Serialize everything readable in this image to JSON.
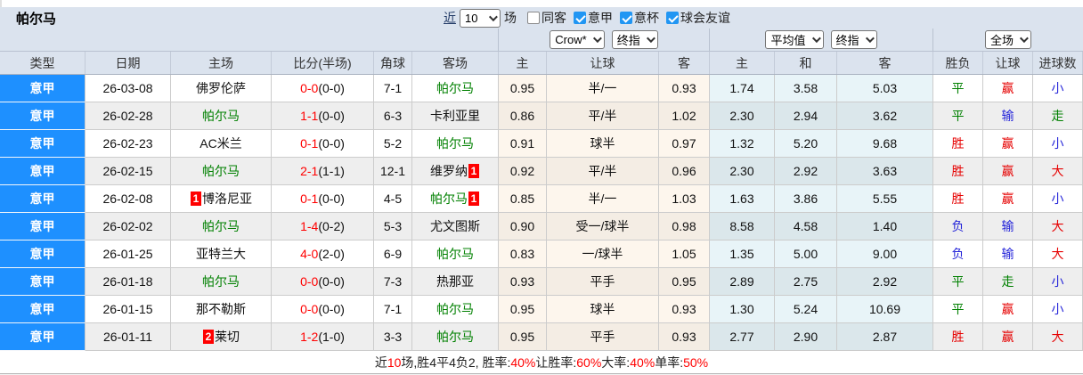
{
  "theme": {
    "accent_blue": "#1e90ff",
    "header_bg": "#dbe3ee",
    "green": "#008000",
    "red": "#e60000",
    "blue": "#2626d9",
    "score_red": "#ff0000"
  },
  "team_header": {
    "title": "帕尔马",
    "near_label": "近",
    "matches_select_value": "10",
    "matches_suffix": "场",
    "filters": [
      {
        "label": "同客",
        "checked": false
      },
      {
        "label": "意甲",
        "checked": true
      },
      {
        "label": "意杯",
        "checked": true
      },
      {
        "label": "球会友谊",
        "checked": true
      }
    ]
  },
  "filter_row": {
    "asia_selects": [
      "Crow*",
      "终指"
    ],
    "euro_selects": [
      "平均值",
      "终指"
    ],
    "scope_select": "全场"
  },
  "table": {
    "columns": [
      "类型",
      "日期",
      "主场",
      "比分(半场)",
      "角球",
      "客场",
      "主",
      "让球",
      "客",
      "主",
      "和",
      "客",
      "胜负",
      "让球",
      "进球数"
    ],
    "rows": [
      {
        "league": "意甲",
        "date": "26-03-08",
        "home": "佛罗伦萨",
        "home_green": false,
        "home_badge": "",
        "score": "0-0",
        "half": "(0-0)",
        "corner": "7-1",
        "away": "帕尔马",
        "away_green": true,
        "away_badge": "",
        "asia": [
          "0.95",
          "半/一",
          "0.93"
        ],
        "euro": [
          "1.74",
          "3.58",
          "5.03"
        ],
        "result": {
          "text": "平",
          "color": "green"
        },
        "handicap": {
          "text": "赢",
          "color": "red"
        },
        "goals": {
          "text": "小",
          "color": "blue"
        }
      },
      {
        "league": "意甲",
        "date": "26-02-28",
        "home": "帕尔马",
        "home_green": true,
        "home_badge": "",
        "score": "1-1",
        "half": "(0-0)",
        "corner": "6-3",
        "away": "卡利亚里",
        "away_green": false,
        "away_badge": "",
        "asia": [
          "0.86",
          "平/半",
          "1.02"
        ],
        "euro": [
          "2.30",
          "2.94",
          "3.62"
        ],
        "result": {
          "text": "平",
          "color": "green"
        },
        "handicap": {
          "text": "输",
          "color": "blue"
        },
        "goals": {
          "text": "走",
          "color": "green"
        }
      },
      {
        "league": "意甲",
        "date": "26-02-23",
        "home": "AC米兰",
        "home_green": false,
        "home_badge": "",
        "score": "0-1",
        "half": "(0-0)",
        "corner": "5-2",
        "away": "帕尔马",
        "away_green": true,
        "away_badge": "",
        "asia": [
          "0.91",
          "球半",
          "0.97"
        ],
        "euro": [
          "1.32",
          "5.20",
          "9.68"
        ],
        "result": {
          "text": "胜",
          "color": "red"
        },
        "handicap": {
          "text": "赢",
          "color": "red"
        },
        "goals": {
          "text": "小",
          "color": "blue"
        }
      },
      {
        "league": "意甲",
        "date": "26-02-15",
        "home": "帕尔马",
        "home_green": true,
        "home_badge": "",
        "score": "2-1",
        "half": "(1-1)",
        "corner": "12-1",
        "away": "维罗纳",
        "away_green": false,
        "away_badge": "1",
        "asia": [
          "0.92",
          "平/半",
          "0.96"
        ],
        "euro": [
          "2.30",
          "2.92",
          "3.63"
        ],
        "result": {
          "text": "胜",
          "color": "red"
        },
        "handicap": {
          "text": "赢",
          "color": "red"
        },
        "goals": {
          "text": "大",
          "color": "red"
        }
      },
      {
        "league": "意甲",
        "date": "26-02-08",
        "home": "博洛尼亚",
        "home_green": false,
        "home_badge": "1",
        "score": "0-1",
        "half": "(0-0)",
        "corner": "4-5",
        "away": "帕尔马",
        "away_green": true,
        "away_badge": "1",
        "asia": [
          "0.85",
          "半/一",
          "1.03"
        ],
        "euro": [
          "1.63",
          "3.86",
          "5.55"
        ],
        "result": {
          "text": "胜",
          "color": "red"
        },
        "handicap": {
          "text": "赢",
          "color": "red"
        },
        "goals": {
          "text": "小",
          "color": "blue"
        }
      },
      {
        "league": "意甲",
        "date": "26-02-02",
        "home": "帕尔马",
        "home_green": true,
        "home_badge": "",
        "score": "1-4",
        "half": "(0-2)",
        "corner": "5-3",
        "away": "尤文图斯",
        "away_green": false,
        "away_badge": "",
        "asia": [
          "0.90",
          "受一/球半",
          "0.98"
        ],
        "euro": [
          "8.58",
          "4.58",
          "1.40"
        ],
        "result": {
          "text": "负",
          "color": "blue"
        },
        "handicap": {
          "text": "输",
          "color": "blue"
        },
        "goals": {
          "text": "大",
          "color": "red"
        }
      },
      {
        "league": "意甲",
        "date": "26-01-25",
        "home": "亚特兰大",
        "home_green": false,
        "home_badge": "",
        "score": "4-0",
        "half": "(2-0)",
        "corner": "6-9",
        "away": "帕尔马",
        "away_green": true,
        "away_badge": "",
        "asia": [
          "0.83",
          "一/球半",
          "1.05"
        ],
        "euro": [
          "1.35",
          "5.00",
          "9.00"
        ],
        "result": {
          "text": "负",
          "color": "blue"
        },
        "handicap": {
          "text": "输",
          "color": "blue"
        },
        "goals": {
          "text": "大",
          "color": "red"
        }
      },
      {
        "league": "意甲",
        "date": "26-01-18",
        "home": "帕尔马",
        "home_green": true,
        "home_badge": "",
        "score": "0-0",
        "half": "(0-0)",
        "corner": "7-3",
        "away": "热那亚",
        "away_green": false,
        "away_badge": "",
        "asia": [
          "0.93",
          "平手",
          "0.95"
        ],
        "euro": [
          "2.89",
          "2.75",
          "2.92"
        ],
        "result": {
          "text": "平",
          "color": "green"
        },
        "handicap": {
          "text": "走",
          "color": "green"
        },
        "goals": {
          "text": "小",
          "color": "blue"
        }
      },
      {
        "league": "意甲",
        "date": "26-01-15",
        "home": "那不勒斯",
        "home_green": false,
        "home_badge": "",
        "score": "0-0",
        "half": "(0-0)",
        "corner": "7-1",
        "away": "帕尔马",
        "away_green": true,
        "away_badge": "",
        "asia": [
          "0.95",
          "球半",
          "0.93"
        ],
        "euro": [
          "1.30",
          "5.24",
          "10.69"
        ],
        "result": {
          "text": "平",
          "color": "green"
        },
        "handicap": {
          "text": "赢",
          "color": "red"
        },
        "goals": {
          "text": "小",
          "color": "blue"
        }
      },
      {
        "league": "意甲",
        "date": "26-01-11",
        "home": "莱切",
        "home_green": false,
        "home_badge": "2",
        "score": "1-2",
        "half": "(1-0)",
        "corner": "3-3",
        "away": "帕尔马",
        "away_green": true,
        "away_badge": "",
        "asia": [
          "0.95",
          "平手",
          "0.93"
        ],
        "euro": [
          "2.77",
          "2.90",
          "2.87"
        ],
        "result": {
          "text": "胜",
          "color": "red"
        },
        "handicap": {
          "text": "赢",
          "color": "red"
        },
        "goals": {
          "text": "大",
          "color": "red"
        }
      }
    ]
  },
  "footer": {
    "segments": [
      {
        "text": "近",
        "red": false
      },
      {
        "text": "10",
        "red": true
      },
      {
        "text": "场,胜4平4负2, 胜率:",
        "red": false
      },
      {
        "text": "40%",
        "red": true
      },
      {
        "text": " 让胜率:",
        "red": false
      },
      {
        "text": "60%",
        "red": true
      },
      {
        "text": " 大率:",
        "red": false
      },
      {
        "text": "40%",
        "red": true
      },
      {
        "text": " 单率:",
        "red": false
      },
      {
        "text": "50%",
        "red": true
      }
    ]
  }
}
